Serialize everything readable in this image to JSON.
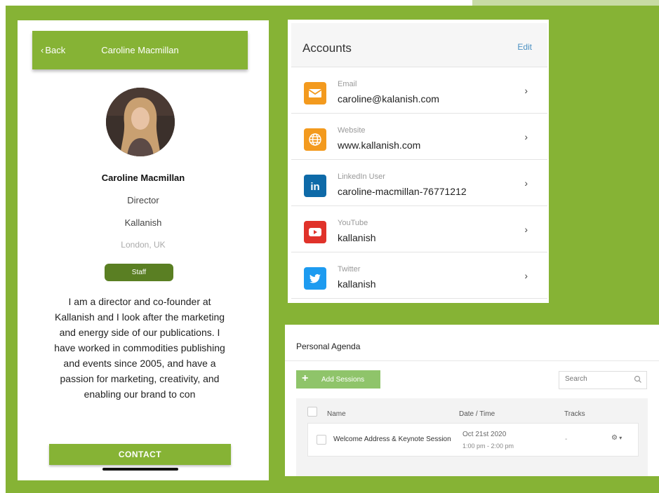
{
  "colors": {
    "accent": "#86b335",
    "staff_badge": "#5a7f23",
    "add_button": "#8fc46a",
    "link": "#4a90c2"
  },
  "profile": {
    "back_label": "Back",
    "header_title": "Caroline Macmillan",
    "name": "Caroline Macmillan",
    "role": "Director",
    "company": "Kallanish",
    "location": "London, UK",
    "badge": "Staff",
    "bio": "I am a director and co-founder at Kallanish and I look after the marketing and energy side of our publications. I have worked in commodities publishing and events since 2005, and have a passion for marketing, creativity, and enabling our brand to con",
    "contact_label": "CONTACT"
  },
  "accounts": {
    "title": "Accounts",
    "edit_label": "Edit",
    "items": [
      {
        "label": "Email",
        "value": "caroline@kalanish.com",
        "icon": "email-icon",
        "color": "#f39a1e"
      },
      {
        "label": "Website",
        "value": "www.kallanish.com",
        "icon": "globe-icon",
        "color": "#f39a1e"
      },
      {
        "label": "LinkedIn User",
        "value": "caroline-macmillan-76771212",
        "icon": "linkedin-icon",
        "color": "#0e6aa8"
      },
      {
        "label": "YouTube",
        "value": "kallanish",
        "icon": "youtube-icon",
        "color": "#e0322a"
      },
      {
        "label": "Twitter",
        "value": "kallanish",
        "icon": "twitter-icon",
        "color": "#1d9bf0"
      }
    ]
  },
  "agenda": {
    "title": "Personal Agenda",
    "add_label": "Add Sessions",
    "search_placeholder": "Search",
    "columns": {
      "name": "Name",
      "datetime": "Date / Time",
      "tracks": "Tracks"
    },
    "rows": [
      {
        "name": "Welcome Address & Keynote Session",
        "date": "Oct 21st 2020",
        "time": "1:00 pm - 2:00 pm",
        "tracks": "-"
      }
    ]
  }
}
